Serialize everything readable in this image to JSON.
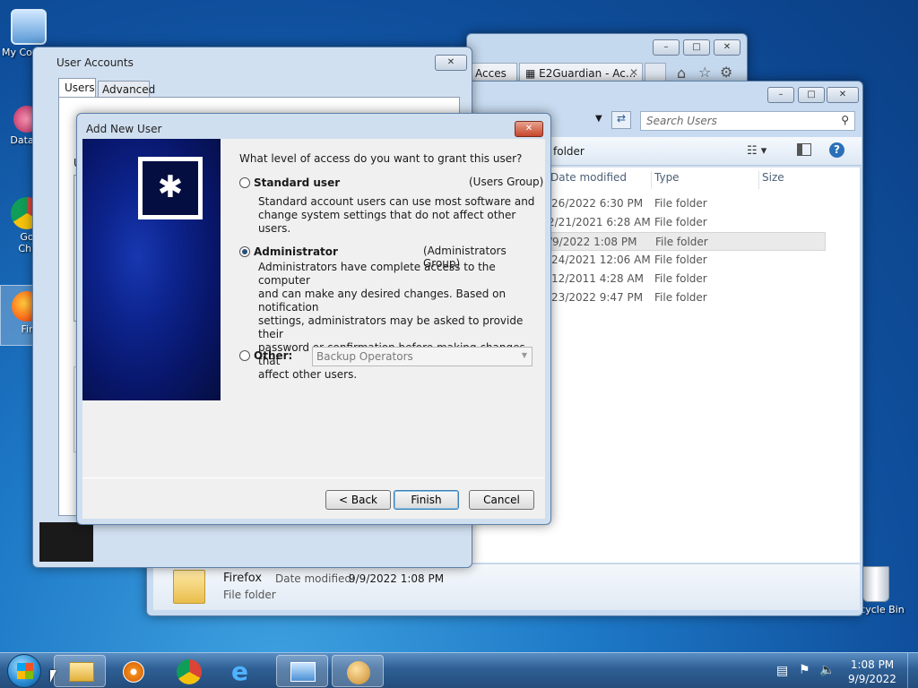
{
  "desktop": {
    "icons": [
      {
        "label": "My Co",
        "icon": "computer-icon"
      },
      {
        "label": "DataW",
        "icon": "datawarehouse-icon"
      },
      {
        "label": "Go",
        "label2": "Chr",
        "icon": "chrome-icon"
      },
      {
        "label": "Fir",
        "icon": "firefox-icon"
      },
      {
        "label": "Recycle Bin",
        "icon": "recycle-bin-icon"
      }
    ]
  },
  "browser": {
    "tabs": [
      {
        "label": "Acces"
      },
      {
        "label": "E2Guardian - Ac..."
      }
    ]
  },
  "explorer": {
    "search_placeholder": "Search Users",
    "breadcrumb_tail": "folder",
    "columns": {
      "date": "Date modified",
      "type": "Type",
      "size": "Size"
    },
    "rows": [
      {
        "date": "/26/2022 6:30 PM",
        "type": "File folder"
      },
      {
        "date": "2/21/2021 6:28 AM",
        "type": "File folder"
      },
      {
        "date": "/9/2022 1:08 PM",
        "type": "File folder"
      },
      {
        "date": "/24/2021 12:06 AM",
        "type": "File folder"
      },
      {
        "date": "/12/2011 4:28 AM",
        "type": "File folder"
      },
      {
        "date": "/23/2022 9:47 PM",
        "type": "File folder"
      }
    ],
    "details": {
      "name": "Firefox",
      "date_label": "Date modified:",
      "date_value": "9/9/2022 1:08 PM",
      "kind": "File folder"
    }
  },
  "user_accounts": {
    "title": "User Accounts",
    "tabs": [
      {
        "label": "Users"
      },
      {
        "label": "Advanced"
      }
    ],
    "partial_label": "U"
  },
  "dialog": {
    "title": "Add New User",
    "question": "What level of access do you want to grant this user?",
    "options": [
      {
        "label": "Standard user",
        "group": "(Users Group)",
        "desc": [
          "Standard account users can use most software and",
          "change system settings that do not affect other users."
        ],
        "checked": false
      },
      {
        "label": "Administrator",
        "group": "(Administrators Group)",
        "desc": [
          "Administrators have complete access to the computer",
          "and can make any desired changes. Based on notification",
          "settings, administrators may be asked to provide their",
          "password or confirmation before making changes that",
          "affect other users."
        ],
        "checked": true
      }
    ],
    "other": {
      "label": "Other:",
      "select_value": "Backup Operators"
    },
    "buttons": {
      "back": "< Back",
      "finish": "Finish",
      "cancel": "Cancel"
    }
  },
  "taskbar": {
    "time": "1:08 PM",
    "date": "9/9/2022"
  },
  "colors": {
    "dialog_banner": "#0b1a6e",
    "close_red": "#c6452a",
    "taskbar": "#2e5f94"
  }
}
